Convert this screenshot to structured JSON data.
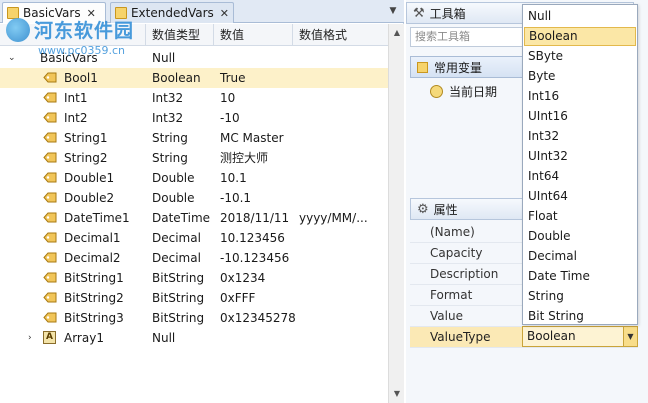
{
  "tabs": [
    {
      "label": "BasicVars",
      "active": true
    },
    {
      "label": "ExtendedVars",
      "active": false
    }
  ],
  "grid": {
    "headers": [
      "数值类型",
      "数值",
      "数值格式"
    ],
    "root_label": "BasicVars",
    "root_type": "Null",
    "rows": [
      {
        "name": "Bool1",
        "type": "Boolean",
        "value": "True",
        "format": ""
      },
      {
        "name": "Int1",
        "type": "Int32",
        "value": "10",
        "format": ""
      },
      {
        "name": "Int2",
        "type": "Int32",
        "value": "-10",
        "format": ""
      },
      {
        "name": "String1",
        "type": "String",
        "value": "MC Master",
        "format": ""
      },
      {
        "name": "String2",
        "type": "String",
        "value": "测控大师",
        "format": ""
      },
      {
        "name": "Double1",
        "type": "Double",
        "value": "10.1",
        "format": ""
      },
      {
        "name": "Double2",
        "type": "Double",
        "value": "-10.1",
        "format": ""
      },
      {
        "name": "DateTime1",
        "type": "DateTime",
        "value": "2018/11/11",
        "format": "yyyy/MM/..."
      },
      {
        "name": "Decimal1",
        "type": "Decimal",
        "value": "10.123456",
        "format": ""
      },
      {
        "name": "Decimal2",
        "type": "Decimal",
        "value": "-10.123456",
        "format": ""
      },
      {
        "name": "BitString1",
        "type": "BitString",
        "value": "0x1234",
        "format": ""
      },
      {
        "name": "BitString2",
        "type": "BitString",
        "value": "0xFFF",
        "format": ""
      },
      {
        "name": "BitString3",
        "type": "BitString",
        "value": "0x12345278",
        "format": ""
      },
      {
        "name": "Array1",
        "type": "Null",
        "value": "",
        "format": ""
      }
    ],
    "selected_row": 0
  },
  "toolbox": {
    "title": "工具箱",
    "search_placeholder": "搜索工具箱",
    "group": "常用变量",
    "item": "当前日期"
  },
  "properties": {
    "title": "属性",
    "rows": [
      "(Name)",
      "Capacity",
      "Description",
      "Format",
      "Value",
      "ValueType"
    ],
    "selected": "ValueType",
    "value_type": "Boolean"
  },
  "dropdown": {
    "options": [
      "Null",
      "Boolean",
      "SByte",
      "Byte",
      "Int16",
      "UInt16",
      "Int32",
      "UInt32",
      "Int64",
      "UInt64",
      "Float",
      "Double",
      "Decimal",
      "Date Time",
      "String",
      "Bit String"
    ],
    "highlighted": "Boolean"
  },
  "watermark": {
    "title": "河东软件园",
    "url": "www.pc0359.cn"
  },
  "colors": {
    "selection": "#fdf1c9",
    "accent_blue": "#2a8ad6"
  }
}
